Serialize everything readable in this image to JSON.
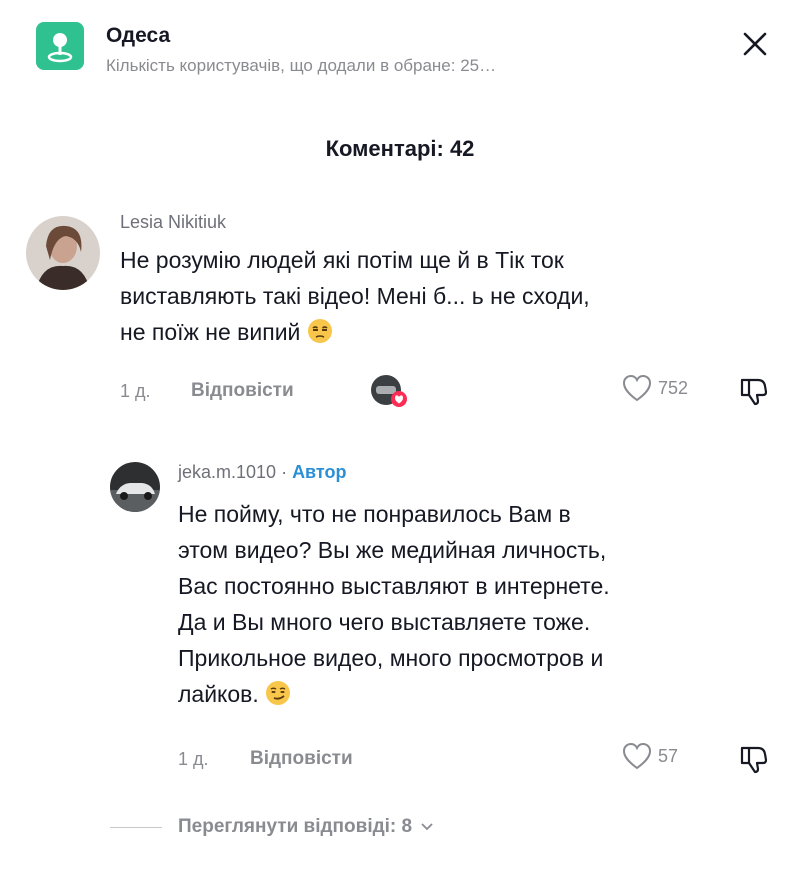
{
  "location_banner": {
    "title": "Одеса",
    "subtitle": "Кількість користувачів, що додали в обране: 25…",
    "icon": "map-pin-icon",
    "accent_color": "#2fc18f"
  },
  "comments_header": {
    "title": "Коментарі: 42"
  },
  "comments": [
    {
      "username": "Lesia Nikitiuk",
      "lines": [
        "Не розумію людей які потім ще й в Тік ток",
        "виставляють такі відео! Мені б... ь не сходи,",
        "не поїж не випий"
      ],
      "emoji": "unamused-face-icon",
      "time": "1 д.",
      "reply_label": "Відповісти",
      "likes": "752",
      "author_liked": true
    },
    {
      "username": "jeka.m.1010",
      "separator": "·",
      "badge": "Автор",
      "lines": [
        "Не пойму, что не понравилось Вам в",
        "этом видео? Вы же медийная личность,",
        "Вас постоянно выставляют в интернете.",
        "Да и Вы много чего выставляете тоже.",
        "Прикольное видео, много просмотров и",
        "лайков."
      ],
      "emoji": "smirking-face-icon",
      "time": "1 д.",
      "reply_label": "Відповісти",
      "likes": "57"
    }
  ],
  "view_replies": {
    "label": "Переглянути відповіді: 8"
  }
}
